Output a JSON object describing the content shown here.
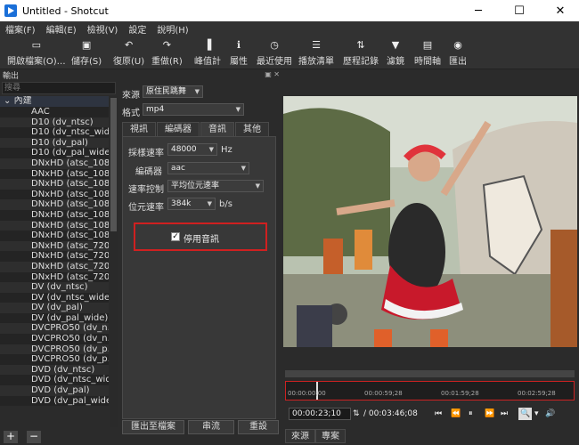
{
  "window": {
    "title": "Untitled - Shotcut",
    "minimize": "─",
    "maximize": "☐",
    "close": "✕"
  },
  "menu": [
    "檔案(F)",
    "編輯(E)",
    "檢視(V)",
    "設定",
    "說明(H)"
  ],
  "toolbar": [
    {
      "label": "開啟檔案(O)…",
      "icon": "▭"
    },
    {
      "label": "儲存(S)",
      "icon": "▣"
    },
    {
      "label": "復原(U)",
      "icon": "↶"
    },
    {
      "label": "重做(R)",
      "icon": "↷"
    },
    {
      "label": "峰值計",
      "icon": "▐"
    },
    {
      "label": "屬性",
      "icon": "ℹ"
    },
    {
      "label": "最近使用",
      "icon": "◷"
    },
    {
      "label": "播放清單",
      "icon": "☰"
    },
    {
      "label": "歷程記錄",
      "icon": "⇅"
    },
    {
      "label": "濾鏡",
      "icon": "▼"
    },
    {
      "label": "時間軸",
      "icon": "▤"
    },
    {
      "label": "匯出",
      "icon": "◉"
    }
  ],
  "export_panel": {
    "title": "輸出",
    "search_placeholder": "搜尋",
    "root": "內建",
    "presets": [
      "AAC",
      "D10 (dv_ntsc)",
      "D10 (dv_ntsc_wide)",
      "D10 (dv_pal)",
      "D10 (dv_pal_wide)",
      "DNxHD (atsc_108…",
      "DNxHD (atsc_108…",
      "DNxHD (atsc_108…",
      "DNxHD (atsc_108…",
      "DNxHD (atsc_108…",
      "DNxHD (atsc_108…",
      "DNxHD (atsc_108…",
      "DNxHD (atsc_108…",
      "DNxHD (atsc_720…",
      "DNxHD (atsc_720…",
      "DNxHD (atsc_720…",
      "DNxHD (atsc_720…",
      "DV (dv_ntsc)",
      "DV (dv_ntsc_wide)",
      "DV (dv_pal)",
      "DV (dv_pal_wide)",
      "DVCPRO50 (dv_n…",
      "DVCPRO50 (dv_n…",
      "DVCPRO50 (dv_p…",
      "DVCPRO50 (dv_p…",
      "DVD (dv_ntsc)",
      "DVD (dv_ntsc_wide)",
      "DVD (dv_pal)",
      "DVD (dv_pal_wide)"
    ],
    "add_label": "+",
    "remove_label": "−"
  },
  "settings": {
    "source_label": "來源",
    "source_value": "原住民跳舞",
    "format_label": "格式",
    "format_value": "mp4",
    "tabs": [
      "視訊",
      "編碼器",
      "音訊",
      "其他"
    ],
    "active_tab": 2,
    "sample_rate_label": "採樣速率",
    "sample_rate_value": "48000",
    "sample_rate_unit": "Hz",
    "codec_label": "編碼器",
    "codec_value": "aac",
    "rate_control_label": "速率控制",
    "rate_control_value": "平均位元速率",
    "bitrate_label": "位元速率",
    "bitrate_value": "384k",
    "bitrate_unit": "b/s",
    "disable_audio_label": "停用音訊",
    "export_file_label": "匯出至檔案",
    "stream_label": "串流",
    "reset_label": "重設"
  },
  "player": {
    "ruler_ticks": [
      "00:00:00;00",
      "00:00:59;28",
      "00:01:59;28",
      "00:02:59;28"
    ],
    "current_time": "00:00:23;10",
    "total_time": "/ 00:03:46;08",
    "tabs": [
      "來源",
      "專案"
    ]
  }
}
